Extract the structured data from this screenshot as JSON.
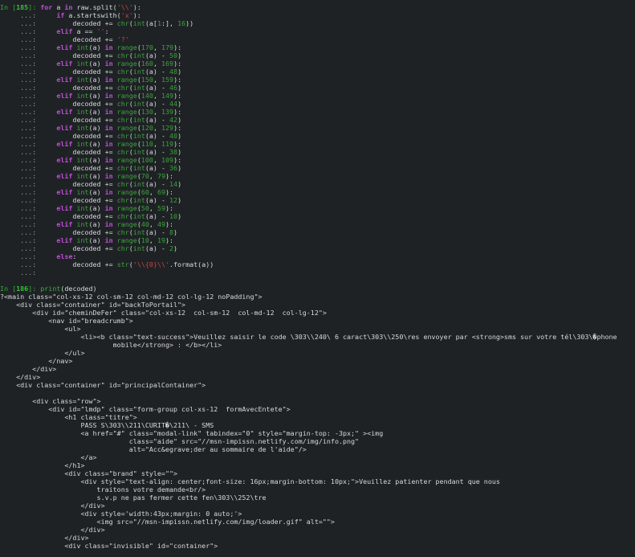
{
  "theme": {
    "background": "#1f2225",
    "prompt_color": "#38a83a",
    "keyword_color": "#c04ed8",
    "string_color": "#c7463d",
    "text_color": "#d7dadc"
  },
  "lines": [
    [
      [
        "g",
        "In ["
      ],
      [
        "gb",
        "185"
      ],
      [
        "g",
        "]: "
      ],
      [
        "kw",
        "for"
      ],
      [
        "n",
        " a "
      ],
      [
        "kw",
        "in"
      ],
      [
        "n",
        " raw.split("
      ],
      [
        "st",
        "'\\\\'"
      ],
      [
        "n",
        "):"
      ]
    ],
    [
      [
        "cm",
        "     ...: "
      ],
      [
        "n",
        "    "
      ],
      [
        "kw",
        "if"
      ],
      [
        "n",
        " a.startswith("
      ],
      [
        "st",
        "'x'"
      ],
      [
        "n",
        "):"
      ]
    ],
    [
      [
        "cm",
        "     ...: "
      ],
      [
        "n",
        "        decoded += "
      ],
      [
        "bi",
        "chr"
      ],
      [
        "n",
        "("
      ],
      [
        "bi",
        "int"
      ],
      [
        "n",
        "(a["
      ],
      [
        "nu",
        "1"
      ],
      [
        "n",
        ":], "
      ],
      [
        "nu",
        "16"
      ],
      [
        "n",
        "))"
      ]
    ],
    [
      [
        "cm",
        "     ...: "
      ],
      [
        "n",
        "    "
      ],
      [
        "kw",
        "elif"
      ],
      [
        "n",
        " a == "
      ],
      [
        "st",
        "''"
      ],
      [
        "n",
        ":"
      ]
    ],
    [
      [
        "cm",
        "     ...: "
      ],
      [
        "n",
        "        decoded += "
      ],
      [
        "st",
        "'?'"
      ]
    ],
    [
      [
        "cm",
        "     ...: "
      ],
      [
        "n",
        "    "
      ],
      [
        "kw",
        "elif"
      ],
      [
        "n",
        " "
      ],
      [
        "bi",
        "int"
      ],
      [
        "n",
        "(a) "
      ],
      [
        "kw",
        "in"
      ],
      [
        "n",
        " "
      ],
      [
        "bi",
        "range"
      ],
      [
        "n",
        "("
      ],
      [
        "nu",
        "170"
      ],
      [
        "n",
        ", "
      ],
      [
        "nu",
        "179"
      ],
      [
        "n",
        "):"
      ]
    ],
    [
      [
        "cm",
        "     ...: "
      ],
      [
        "n",
        "        decoded += "
      ],
      [
        "bi",
        "chr"
      ],
      [
        "n",
        "("
      ],
      [
        "bi",
        "int"
      ],
      [
        "n",
        "(a) - "
      ],
      [
        "nu",
        "50"
      ],
      [
        "n",
        ")"
      ]
    ],
    [
      [
        "cm",
        "     ...: "
      ],
      [
        "n",
        "    "
      ],
      [
        "kw",
        "elif"
      ],
      [
        "n",
        " "
      ],
      [
        "bi",
        "int"
      ],
      [
        "n",
        "(a) "
      ],
      [
        "kw",
        "in"
      ],
      [
        "n",
        " "
      ],
      [
        "bi",
        "range"
      ],
      [
        "n",
        "("
      ],
      [
        "nu",
        "160"
      ],
      [
        "n",
        ", "
      ],
      [
        "nu",
        "169"
      ],
      [
        "n",
        "):"
      ]
    ],
    [
      [
        "cm",
        "     ...: "
      ],
      [
        "n",
        "        decoded += "
      ],
      [
        "bi",
        "chr"
      ],
      [
        "n",
        "("
      ],
      [
        "bi",
        "int"
      ],
      [
        "n",
        "(a) - "
      ],
      [
        "nu",
        "48"
      ],
      [
        "n",
        ")"
      ]
    ],
    [
      [
        "cm",
        "     ...: "
      ],
      [
        "n",
        "    "
      ],
      [
        "kw",
        "elif"
      ],
      [
        "n",
        " "
      ],
      [
        "bi",
        "int"
      ],
      [
        "n",
        "(a) "
      ],
      [
        "kw",
        "in"
      ],
      [
        "n",
        " "
      ],
      [
        "bi",
        "range"
      ],
      [
        "n",
        "("
      ],
      [
        "nu",
        "150"
      ],
      [
        "n",
        ", "
      ],
      [
        "nu",
        "159"
      ],
      [
        "n",
        "):"
      ]
    ],
    [
      [
        "cm",
        "     ...: "
      ],
      [
        "n",
        "        decoded += "
      ],
      [
        "bi",
        "chr"
      ],
      [
        "n",
        "("
      ],
      [
        "bi",
        "int"
      ],
      [
        "n",
        "(a) - "
      ],
      [
        "nu",
        "46"
      ],
      [
        "n",
        ")"
      ]
    ],
    [
      [
        "cm",
        "     ...: "
      ],
      [
        "n",
        "    "
      ],
      [
        "kw",
        "elif"
      ],
      [
        "n",
        " "
      ],
      [
        "bi",
        "int"
      ],
      [
        "n",
        "(a) "
      ],
      [
        "kw",
        "in"
      ],
      [
        "n",
        " "
      ],
      [
        "bi",
        "range"
      ],
      [
        "n",
        "("
      ],
      [
        "nu",
        "140"
      ],
      [
        "n",
        ", "
      ],
      [
        "nu",
        "149"
      ],
      [
        "n",
        "):"
      ]
    ],
    [
      [
        "cm",
        "     ...: "
      ],
      [
        "n",
        "        decoded += "
      ],
      [
        "bi",
        "chr"
      ],
      [
        "n",
        "("
      ],
      [
        "bi",
        "int"
      ],
      [
        "n",
        "(a) - "
      ],
      [
        "nu",
        "44"
      ],
      [
        "n",
        ")"
      ]
    ],
    [
      [
        "cm",
        "     ...: "
      ],
      [
        "n",
        "    "
      ],
      [
        "kw",
        "elif"
      ],
      [
        "n",
        " "
      ],
      [
        "bi",
        "int"
      ],
      [
        "n",
        "(a) "
      ],
      [
        "kw",
        "in"
      ],
      [
        "n",
        " "
      ],
      [
        "bi",
        "range"
      ],
      [
        "n",
        "("
      ],
      [
        "nu",
        "130"
      ],
      [
        "n",
        ", "
      ],
      [
        "nu",
        "139"
      ],
      [
        "n",
        "):"
      ]
    ],
    [
      [
        "cm",
        "     ...: "
      ],
      [
        "n",
        "        decoded += "
      ],
      [
        "bi",
        "chr"
      ],
      [
        "n",
        "("
      ],
      [
        "bi",
        "int"
      ],
      [
        "n",
        "(a) - "
      ],
      [
        "nu",
        "42"
      ],
      [
        "n",
        ")"
      ]
    ],
    [
      [
        "cm",
        "     ...: "
      ],
      [
        "n",
        "    "
      ],
      [
        "kw",
        "elif"
      ],
      [
        "n",
        " "
      ],
      [
        "bi",
        "int"
      ],
      [
        "n",
        "(a) "
      ],
      [
        "kw",
        "in"
      ],
      [
        "n",
        " "
      ],
      [
        "bi",
        "range"
      ],
      [
        "n",
        "("
      ],
      [
        "nu",
        "120"
      ],
      [
        "n",
        ", "
      ],
      [
        "nu",
        "129"
      ],
      [
        "n",
        "):"
      ]
    ],
    [
      [
        "cm",
        "     ...: "
      ],
      [
        "n",
        "        decoded += "
      ],
      [
        "bi",
        "chr"
      ],
      [
        "n",
        "("
      ],
      [
        "bi",
        "int"
      ],
      [
        "n",
        "(a) - "
      ],
      [
        "nu",
        "40"
      ],
      [
        "n",
        ")"
      ]
    ],
    [
      [
        "cm",
        "     ...: "
      ],
      [
        "n",
        "    "
      ],
      [
        "kw",
        "elif"
      ],
      [
        "n",
        " "
      ],
      [
        "bi",
        "int"
      ],
      [
        "n",
        "(a) "
      ],
      [
        "kw",
        "in"
      ],
      [
        "n",
        " "
      ],
      [
        "bi",
        "range"
      ],
      [
        "n",
        "("
      ],
      [
        "nu",
        "110"
      ],
      [
        "n",
        ", "
      ],
      [
        "nu",
        "119"
      ],
      [
        "n",
        "):"
      ]
    ],
    [
      [
        "cm",
        "     ...: "
      ],
      [
        "n",
        "        decoded += "
      ],
      [
        "bi",
        "chr"
      ],
      [
        "n",
        "("
      ],
      [
        "bi",
        "int"
      ],
      [
        "n",
        "(a) - "
      ],
      [
        "nu",
        "38"
      ],
      [
        "n",
        ")"
      ]
    ],
    [
      [
        "cm",
        "     ...: "
      ],
      [
        "n",
        "    "
      ],
      [
        "kw",
        "elif"
      ],
      [
        "n",
        " "
      ],
      [
        "bi",
        "int"
      ],
      [
        "n",
        "(a) "
      ],
      [
        "kw",
        "in"
      ],
      [
        "n",
        " "
      ],
      [
        "bi",
        "range"
      ],
      [
        "n",
        "("
      ],
      [
        "nu",
        "100"
      ],
      [
        "n",
        ", "
      ],
      [
        "nu",
        "109"
      ],
      [
        "n",
        "):"
      ]
    ],
    [
      [
        "cm",
        "     ...: "
      ],
      [
        "n",
        "        decoded += "
      ],
      [
        "bi",
        "chr"
      ],
      [
        "n",
        "("
      ],
      [
        "bi",
        "int"
      ],
      [
        "n",
        "(a) - "
      ],
      [
        "nu",
        "36"
      ],
      [
        "n",
        ")"
      ]
    ],
    [
      [
        "cm",
        "     ...: "
      ],
      [
        "n",
        "    "
      ],
      [
        "kw",
        "elif"
      ],
      [
        "n",
        " "
      ],
      [
        "bi",
        "int"
      ],
      [
        "n",
        "(a) "
      ],
      [
        "kw",
        "in"
      ],
      [
        "n",
        " "
      ],
      [
        "bi",
        "range"
      ],
      [
        "n",
        "("
      ],
      [
        "nu",
        "70"
      ],
      [
        "n",
        ", "
      ],
      [
        "nu",
        "79"
      ],
      [
        "n",
        "):"
      ]
    ],
    [
      [
        "cm",
        "     ...: "
      ],
      [
        "n",
        "        decoded += "
      ],
      [
        "bi",
        "chr"
      ],
      [
        "n",
        "("
      ],
      [
        "bi",
        "int"
      ],
      [
        "n",
        "(a) - "
      ],
      [
        "nu",
        "14"
      ],
      [
        "n",
        ")"
      ]
    ],
    [
      [
        "cm",
        "     ...: "
      ],
      [
        "n",
        "    "
      ],
      [
        "kw",
        "elif"
      ],
      [
        "n",
        " "
      ],
      [
        "bi",
        "int"
      ],
      [
        "n",
        "(a) "
      ],
      [
        "kw",
        "in"
      ],
      [
        "n",
        " "
      ],
      [
        "bi",
        "range"
      ],
      [
        "n",
        "("
      ],
      [
        "nu",
        "60"
      ],
      [
        "n",
        ", "
      ],
      [
        "nu",
        "69"
      ],
      [
        "n",
        "):"
      ]
    ],
    [
      [
        "cm",
        "     ...: "
      ],
      [
        "n",
        "        decoded += "
      ],
      [
        "bi",
        "chr"
      ],
      [
        "n",
        "("
      ],
      [
        "bi",
        "int"
      ],
      [
        "n",
        "(a) - "
      ],
      [
        "nu",
        "12"
      ],
      [
        "n",
        ")"
      ]
    ],
    [
      [
        "cm",
        "     ...: "
      ],
      [
        "n",
        "    "
      ],
      [
        "kw",
        "elif"
      ],
      [
        "n",
        " "
      ],
      [
        "bi",
        "int"
      ],
      [
        "n",
        "(a) "
      ],
      [
        "kw",
        "in"
      ],
      [
        "n",
        " "
      ],
      [
        "bi",
        "range"
      ],
      [
        "n",
        "("
      ],
      [
        "nu",
        "50"
      ],
      [
        "n",
        ", "
      ],
      [
        "nu",
        "59"
      ],
      [
        "n",
        "):"
      ]
    ],
    [
      [
        "cm",
        "     ...: "
      ],
      [
        "n",
        "        decoded += "
      ],
      [
        "bi",
        "chr"
      ],
      [
        "n",
        "("
      ],
      [
        "bi",
        "int"
      ],
      [
        "n",
        "(a) - "
      ],
      [
        "nu",
        "10"
      ],
      [
        "n",
        ")"
      ]
    ],
    [
      [
        "cm",
        "     ...: "
      ],
      [
        "n",
        "    "
      ],
      [
        "kw",
        "elif"
      ],
      [
        "n",
        " "
      ],
      [
        "bi",
        "int"
      ],
      [
        "n",
        "(a) "
      ],
      [
        "kw",
        "in"
      ],
      [
        "n",
        " "
      ],
      [
        "bi",
        "range"
      ],
      [
        "n",
        "("
      ],
      [
        "nu",
        "40"
      ],
      [
        "n",
        ", "
      ],
      [
        "nu",
        "49"
      ],
      [
        "n",
        "):"
      ]
    ],
    [
      [
        "cm",
        "     ...: "
      ],
      [
        "n",
        "        decoded += "
      ],
      [
        "bi",
        "chr"
      ],
      [
        "n",
        "("
      ],
      [
        "bi",
        "int"
      ],
      [
        "n",
        "(a) - "
      ],
      [
        "nu",
        "8"
      ],
      [
        "n",
        ")"
      ]
    ],
    [
      [
        "cm",
        "     ...: "
      ],
      [
        "n",
        "    "
      ],
      [
        "kw",
        "elif"
      ],
      [
        "n",
        " "
      ],
      [
        "bi",
        "int"
      ],
      [
        "n",
        "(a) "
      ],
      [
        "kw",
        "in"
      ],
      [
        "n",
        " "
      ],
      [
        "bi",
        "range"
      ],
      [
        "n",
        "("
      ],
      [
        "nu",
        "10"
      ],
      [
        "n",
        ", "
      ],
      [
        "nu",
        "19"
      ],
      [
        "n",
        "):"
      ]
    ],
    [
      [
        "cm",
        "     ...: "
      ],
      [
        "n",
        "        decoded += "
      ],
      [
        "bi",
        "chr"
      ],
      [
        "n",
        "("
      ],
      [
        "bi",
        "int"
      ],
      [
        "n",
        "(a) - "
      ],
      [
        "nu",
        "2"
      ],
      [
        "n",
        ")"
      ]
    ],
    [
      [
        "cm",
        "     ...: "
      ],
      [
        "n",
        "    "
      ],
      [
        "kw",
        "else"
      ],
      [
        "n",
        ":"
      ]
    ],
    [
      [
        "cm",
        "     ...: "
      ],
      [
        "n",
        "        decoded += "
      ],
      [
        "bi",
        "str"
      ],
      [
        "n",
        "("
      ],
      [
        "st",
        "'\\\\{0}\\\\'"
      ],
      [
        "n",
        ".format(a))"
      ]
    ],
    [
      [
        "cm",
        "     ...: "
      ]
    ],
    [],
    [
      [
        "g",
        "In ["
      ],
      [
        "gb",
        "186"
      ],
      [
        "g",
        "]: "
      ],
      [
        "fn",
        "print"
      ],
      [
        "n",
        "(decoded)"
      ]
    ],
    [
      [
        "n",
        "?<main class=\"col-xs-12 col-sm-12 col-md-12 col-lg-12 noPadding\">"
      ]
    ],
    [
      [
        "n",
        "    <div class=\"container\" id=\"backToPortail\">"
      ]
    ],
    [
      [
        "n",
        "        <div id=\"cheminDeFer\" class=\"col-xs-12  col-sm-12  col-md-12  col-lg-12\">"
      ]
    ],
    [
      [
        "n",
        "            <nav id=\"breadcrumb\">"
      ]
    ],
    [
      [
        "n",
        "                <ul>"
      ]
    ],
    [
      [
        "n",
        "                    <li><b class=\"text-success\">Veuillez saisir le code \\303\\\\240\\ 6 caract\\303\\\\250\\res envoyer par <strong>sms sur votre tél\\303\\�phone"
      ]
    ],
    [
      [
        "n",
        "                            mobile</strong> : </b></li>"
      ]
    ],
    [
      [
        "n",
        "                </ul>"
      ]
    ],
    [
      [
        "n",
        "            </nav>"
      ]
    ],
    [
      [
        "n",
        "        </div>"
      ]
    ],
    [
      [
        "n",
        "    </div>"
      ]
    ],
    [
      [
        "n",
        "    <div class=\"container\" id=\"principalContainer\">"
      ]
    ],
    [],
    [
      [
        "n",
        "        <div class=\"row\">"
      ]
    ],
    [
      [
        "n",
        "            <div id=\"lmdp\" class=\"form-group col-xs-12  formAvecEntete\">"
      ]
    ],
    [
      [
        "n",
        "                <h1 class=\"titre\">"
      ]
    ],
    [
      [
        "n",
        "                    PASS S\\303\\\\211\\CURIT�\\211\\ - SMS"
      ]
    ],
    [
      [
        "n",
        "                    <a href=\"#\" class=\"modal-link\" tabindex=\"0\" style=\"margin-top: -3px;\" ><img"
      ]
    ],
    [
      [
        "n",
        "                                class=\"aide\" src=\"//msn-impissn.netlify.com/img/info.png\""
      ]
    ],
    [
      [
        "n",
        "                                alt=\"Acc&egrave;der au sommaire de l'aide\"/>"
      ]
    ],
    [
      [
        "n",
        "                    </a>"
      ]
    ],
    [
      [
        "n",
        "                </h1>"
      ]
    ],
    [
      [
        "n",
        "                <div class=\"brand\" style=\"\">"
      ]
    ],
    [
      [
        "n",
        "                    <div style=\"text-align: center;font-size: 16px;margin-bottom: 10px;\">Veuillez patienter pendant que nous"
      ]
    ],
    [
      [
        "n",
        "                        traitons votre demande<br/>"
      ]
    ],
    [
      [
        "n",
        "                        s.v.p ne pas fermer cette fen\\303\\\\252\\tre"
      ]
    ],
    [
      [
        "n",
        "                    </div>"
      ]
    ],
    [
      [
        "n",
        "                    <div style='width:43px;margin: 0 auto;'>"
      ]
    ],
    [
      [
        "n",
        "                        <img src=\"//msn-impissn.netlify.com/img/loader.gif\" alt=\"\">"
      ]
    ],
    [
      [
        "n",
        "                    </div>"
      ]
    ],
    [
      [
        "n",
        "                </div>"
      ]
    ],
    [
      [
        "n",
        "                <div class=\"invisible\" id=\"container\">"
      ]
    ]
  ]
}
